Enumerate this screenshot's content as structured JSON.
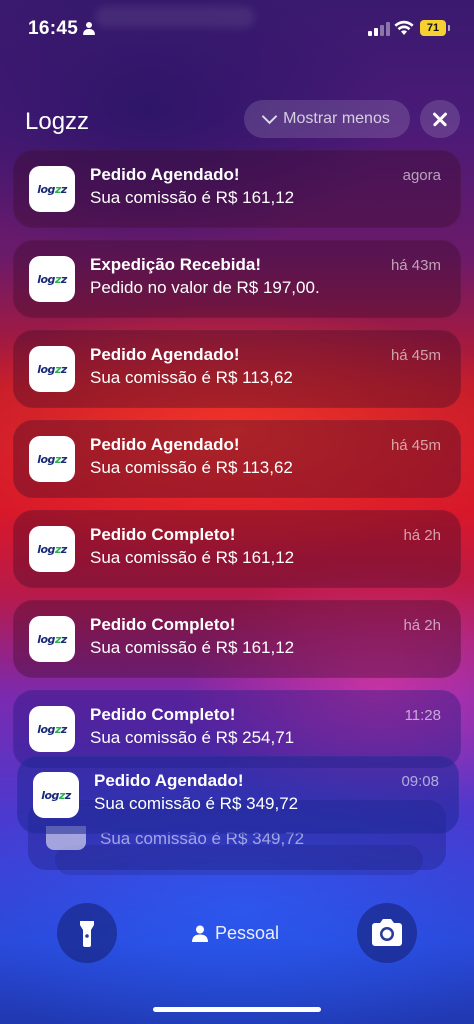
{
  "status_bar": {
    "time": "16:45",
    "battery": "71"
  },
  "group": {
    "app_name": "Logzz",
    "show_less_label": "Mostrar menos"
  },
  "app_logo_text": "logzz",
  "notifications": [
    {
      "title": "Pedido Agendado!",
      "body": "Sua comissão é R$ 161,12",
      "time": "agora"
    },
    {
      "title": "Expedição Recebida!",
      "body": "Pedido no valor de R$ 197,00.",
      "time": "há 43m"
    },
    {
      "title": "Pedido Agendado!",
      "body": "Sua comissão é R$ 113,62",
      "time": "há 45m"
    },
    {
      "title": "Pedido Agendado!",
      "body": "Sua comissão é R$ 113,62",
      "time": "há 45m"
    },
    {
      "title": "Pedido Completo!",
      "body": "Sua comissão é R$ 161,12",
      "time": "há 2h"
    },
    {
      "title": "Pedido Completo!",
      "body": "Sua comissão é R$ 161,12",
      "time": "há 2h"
    },
    {
      "title": "Pedido Completo!",
      "body": "Sua comissão é R$ 254,71",
      "time": "11:28"
    },
    {
      "title": "Pedido Agendado!",
      "body": "Sua comissão é R$ 349,72",
      "time": "09:08"
    }
  ],
  "stacked_preview_text": "Sua comissão é R$ 349,72",
  "lock_screen": {
    "focus_label": "Pessoal"
  },
  "icons": {
    "flashlight": "flashlight-icon",
    "camera": "camera-icon",
    "person": "person-icon"
  }
}
